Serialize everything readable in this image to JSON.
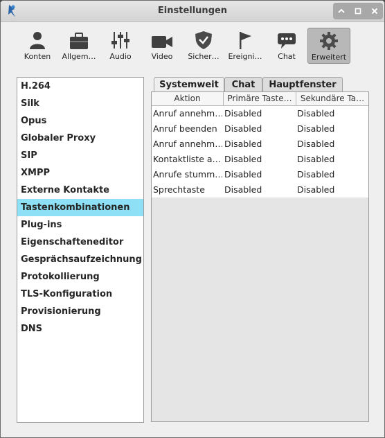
{
  "window": {
    "title": "Einstellungen"
  },
  "toolbar": [
    {
      "label": "Konten",
      "icon": "person-icon"
    },
    {
      "label": "Allgem…",
      "icon": "briefcase-icon"
    },
    {
      "label": "Audio",
      "icon": "sliders-icon"
    },
    {
      "label": "Video",
      "icon": "video-camera-icon"
    },
    {
      "label": "Sicher…",
      "icon": "shield-icon"
    },
    {
      "label": "Ereigni…",
      "icon": "flag-icon"
    },
    {
      "label": "Chat",
      "icon": "chat-bubble-icon"
    },
    {
      "label": "Erweitert",
      "icon": "gear-icon",
      "active": true
    }
  ],
  "sidebar": {
    "items": [
      {
        "label": "H.264"
      },
      {
        "label": "Silk"
      },
      {
        "label": "Opus"
      },
      {
        "label": "Globaler Proxy"
      },
      {
        "label": "SIP"
      },
      {
        "label": "XMPP"
      },
      {
        "label": "Externe Kontakte"
      },
      {
        "label": "Tastenkombinationen",
        "selected": true
      },
      {
        "label": "Plug-ins"
      },
      {
        "label": "Eigenschafteneditor"
      },
      {
        "label": "Gesprächsaufzeichnung"
      },
      {
        "label": "Protokollierung"
      },
      {
        "label": "TLS-Konfiguration"
      },
      {
        "label": "Provisionierung"
      },
      {
        "label": "DNS"
      }
    ]
  },
  "tabs": [
    {
      "label": "Systemweit",
      "active": true
    },
    {
      "label": "Chat"
    },
    {
      "label": "Hauptfenster"
    }
  ],
  "table": {
    "columns": [
      "Aktion",
      "Primäre Taste…",
      "Sekundäre Ta…"
    ],
    "rows": [
      [
        "Anruf annehm…",
        "Disabled",
        "Disabled"
      ],
      [
        "Anruf beenden",
        "Disabled",
        "Disabled"
      ],
      [
        "Anruf annehm…",
        "Disabled",
        "Disabled"
      ],
      [
        "Kontaktliste a…",
        "Disabled",
        "Disabled"
      ],
      [
        "Anrufe stumm…",
        "Disabled",
        "Disabled"
      ],
      [
        "Sprechtaste",
        "Disabled",
        "Disabled"
      ]
    ]
  },
  "colors": {
    "selection": "#8de0f5",
    "window_bg": "#efefef",
    "panel_bg": "#e5e5e5"
  }
}
